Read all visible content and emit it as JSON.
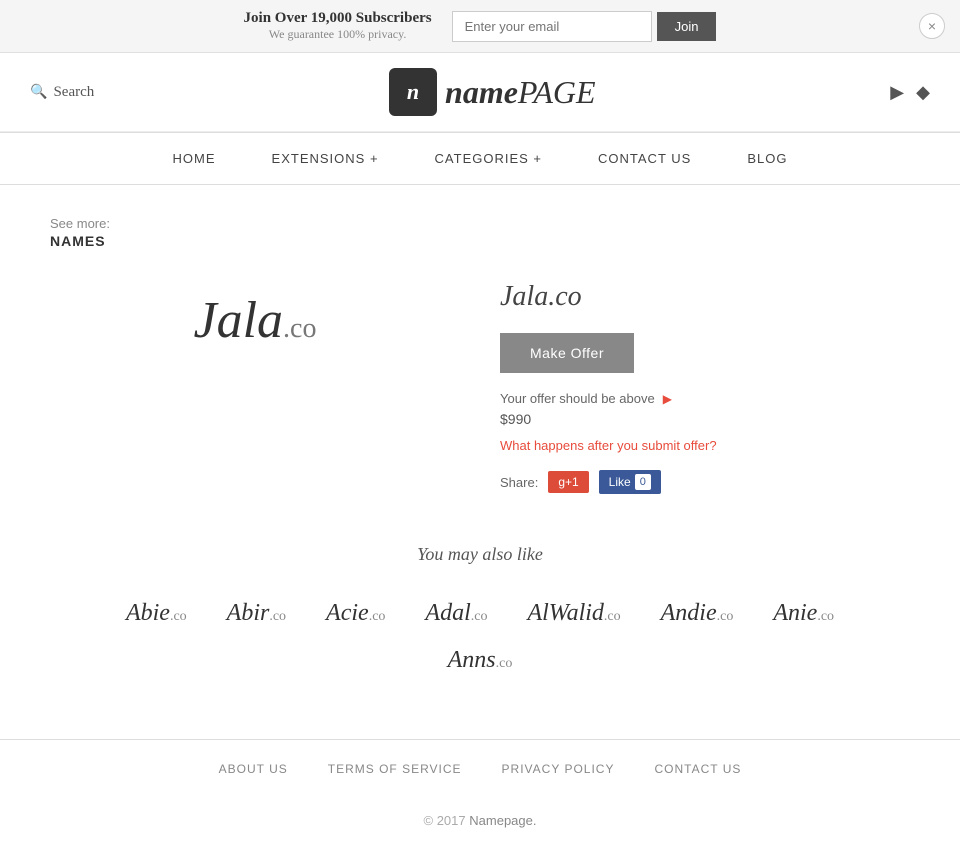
{
  "banner": {
    "main_text": "Join Over 19,000 Subscribers",
    "sub_text": "We guarantee 100% privacy.",
    "email_placeholder": "Enter your email",
    "join_label": "Join",
    "close_label": "×"
  },
  "header": {
    "search_label": "Search",
    "logo_icon": "n",
    "logo_name": "name",
    "logo_page": "PAGE",
    "facebook_icon": "f",
    "twitter_icon": "t"
  },
  "nav": {
    "items": [
      {
        "label": "HOME",
        "id": "home"
      },
      {
        "label": "EXTENSIONS +",
        "id": "extensions"
      },
      {
        "label": "CATEGORIES +",
        "id": "categories"
      },
      {
        "label": "CONTACT US",
        "id": "contact"
      },
      {
        "label": "BLOG",
        "id": "blog"
      }
    ]
  },
  "breadcrumb": {
    "see_more_label": "See more:",
    "link_label": "NAMES"
  },
  "domain": {
    "name": "Jala",
    "tld": ".co",
    "full": "Jala.co",
    "make_offer_label": "Make Offer",
    "offer_above_text": "Your offer should be above",
    "offer_price": "$990",
    "offer_link_text": "What happens after you submit offer?",
    "share_label": "Share:",
    "gplus_label": "g+1",
    "fb_like_label": "Like",
    "fb_count": "0"
  },
  "similar": {
    "title": "You may also like",
    "items": [
      {
        "name": "Abie",
        "tld": ".co"
      },
      {
        "name": "Abir",
        "tld": ".co"
      },
      {
        "name": "Acie",
        "tld": ".co"
      },
      {
        "name": "Adal",
        "tld": ".co"
      },
      {
        "name": "AlWalid",
        "tld": ".co"
      },
      {
        "name": "Andie",
        "tld": ".co"
      },
      {
        "name": "Anie",
        "tld": ".co"
      }
    ],
    "row2": [
      {
        "name": "Anns",
        "tld": ".co"
      }
    ]
  },
  "footer": {
    "links": [
      {
        "label": "ABOUT US",
        "id": "about-us"
      },
      {
        "label": "TERMS OF SERVICE",
        "id": "terms"
      },
      {
        "label": "PRIVACY POLICY",
        "id": "privacy"
      },
      {
        "label": "CONTACT US",
        "id": "contact-us"
      }
    ],
    "copyright": "© 2017",
    "brand": "Namepage."
  }
}
